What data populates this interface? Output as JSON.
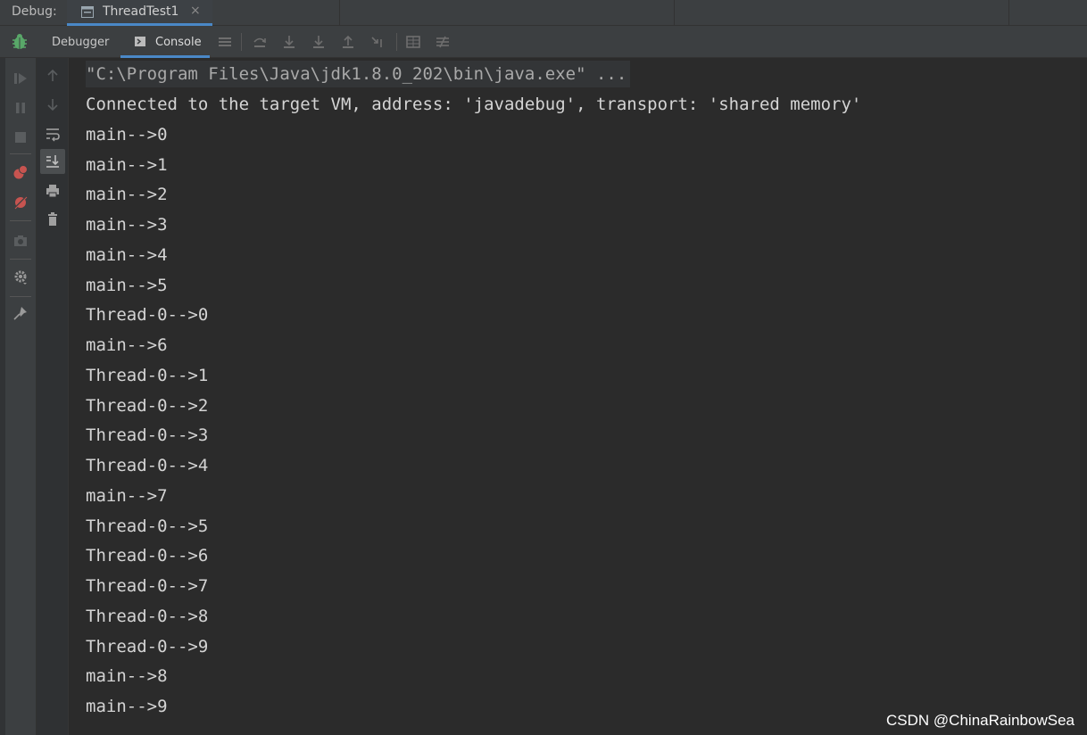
{
  "header": {
    "label": "Debug:",
    "tab_title": "ThreadTest1",
    "tab_close": "×"
  },
  "toolbar": {
    "debugger_label": "Debugger",
    "console_label": "Console",
    "icons": [
      "bug-icon",
      "menu-icon",
      "step-over-icon",
      "step-into-icon",
      "force-step-into-icon",
      "step-out-icon",
      "run-to-cursor-icon",
      "table-icon",
      "settings-sliders-icon"
    ]
  },
  "gutter_icons": [
    "resume-icon",
    "pause-icon",
    "stop-icon",
    "breakpoints-icon",
    "mute-breakpoints-icon",
    "camera-icon",
    "settings-icon",
    "pin-icon"
  ],
  "side_tools": [
    "up-arrow-icon",
    "down-arrow-icon",
    "soft-wrap-icon",
    "scroll-to-end-icon",
    "print-icon",
    "trash-icon"
  ],
  "console": {
    "lines": [
      "\"C:\\Program Files\\Java\\jdk1.8.0_202\\bin\\java.exe\" ...",
      "Connected to the target VM, address: 'javadebug', transport: 'shared memory'",
      "main-->0",
      "main-->1",
      "main-->2",
      "main-->3",
      "main-->4",
      "main-->5",
      "Thread-0-->0",
      "main-->6",
      "Thread-0-->1",
      "Thread-0-->2",
      "Thread-0-->3",
      "Thread-0-->4",
      "main-->7",
      "Thread-0-->5",
      "Thread-0-->6",
      "Thread-0-->7",
      "Thread-0-->8",
      "Thread-0-->9",
      "main-->8",
      "main-->9"
    ]
  },
  "watermark": "CSDN @ChinaRainbowSea",
  "colors": {
    "accent": "#4a88c7",
    "background": "#2b2b2b",
    "panel": "#3c3f41",
    "text": "#d4d4d4"
  }
}
